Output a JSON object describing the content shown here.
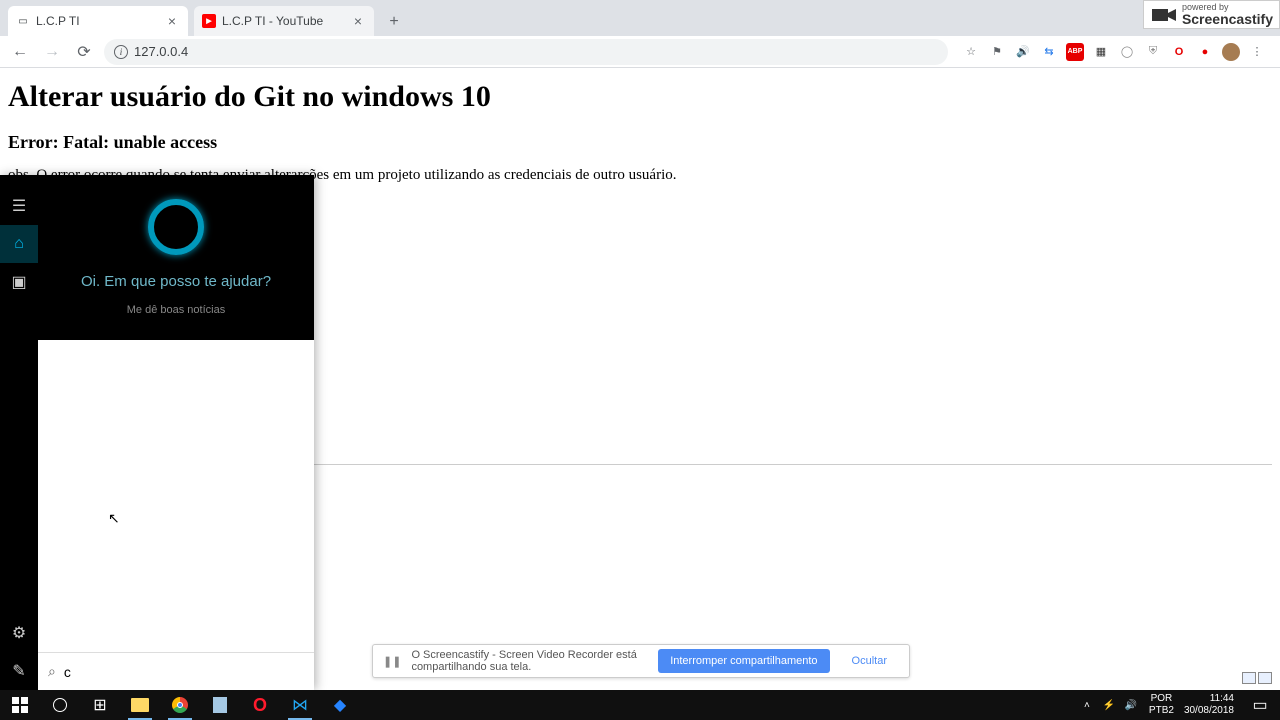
{
  "browser": {
    "tabs": [
      {
        "title": "L.C.P TI",
        "favicon": "doc"
      },
      {
        "title": "L.C.P TI - YouTube",
        "favicon": "yt"
      }
    ],
    "url": "127.0.0.4",
    "extensions": [
      "star",
      "tag",
      "sound",
      "translate",
      "abp",
      "qr",
      "circle",
      "shield",
      "opera",
      "shield2",
      "avatar",
      "menu"
    ]
  },
  "page": {
    "h1": "Alterar usuário do Git no windows 10",
    "h2": "Error: Fatal: unable access",
    "p": "obs. O error ocorre quando se tenta enviar alterarções em um projeto utilizando as credenciais de outro usuário."
  },
  "screencastify": {
    "small": "powered by",
    "brand": "Screencastify"
  },
  "cortana": {
    "greeting": "Oi. Em que posso te ajudar?",
    "suggestion": "Me dê boas notícias",
    "search_value": "c"
  },
  "share_notification": {
    "message": "O Screencastify - Screen Video Recorder está compartilhando sua tela.",
    "primary": "Interromper compartilhamento",
    "secondary": "Ocultar"
  },
  "taskbar": {
    "lang1": "POR",
    "lang2": "PTB2",
    "time": "11:44",
    "date": "30/08/2018"
  }
}
